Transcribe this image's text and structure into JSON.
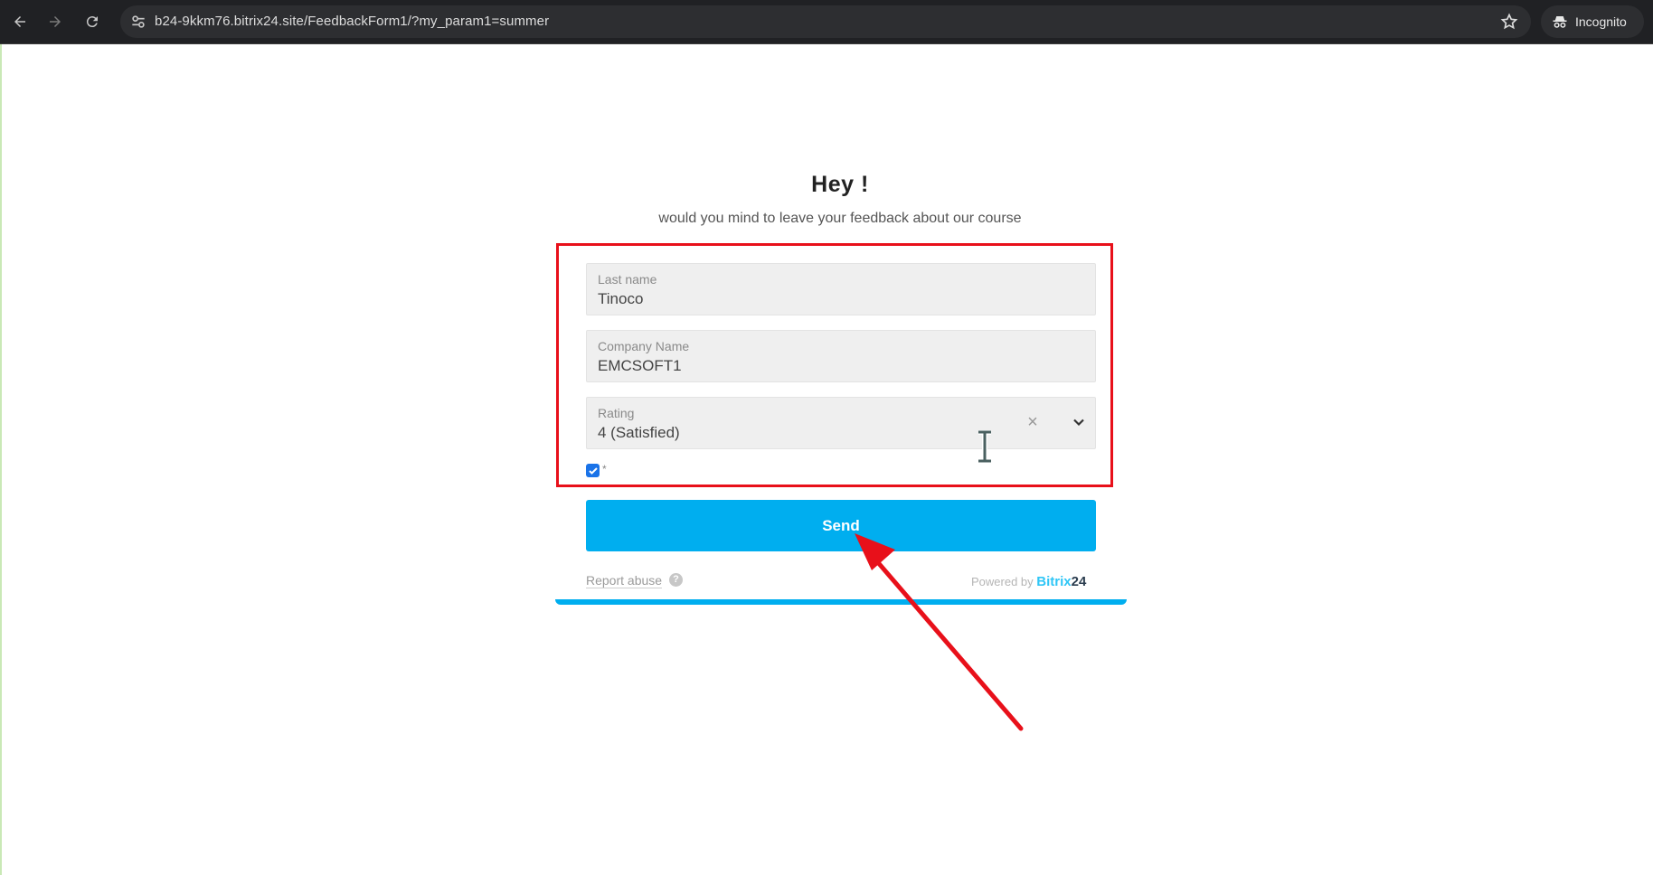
{
  "browser": {
    "url": "b24-9kkm76.bitrix24.site/FeedbackForm1/?my_param1=summer",
    "incognito_label": "Incognito"
  },
  "form": {
    "title": "Hey !",
    "subtitle": "would you mind to leave your feedback about our course",
    "fields": {
      "last_name": {
        "label": "Last name",
        "value": "Tinoco"
      },
      "company": {
        "label": "Company Name",
        "value": "EMCSOFT1"
      },
      "rating": {
        "label": "Rating",
        "value": "4 (Satisfied)"
      }
    },
    "consent_checked": true,
    "consent_marker": "*",
    "send_label": "Send",
    "report_abuse": "Report abuse",
    "help_glyph": "?",
    "powered_by": "Powered by",
    "brand": "Bitrix",
    "brand_num": "24"
  },
  "colors": {
    "accent": "#00aeef",
    "highlight": "#e8101a",
    "toolbar": "#202124"
  }
}
